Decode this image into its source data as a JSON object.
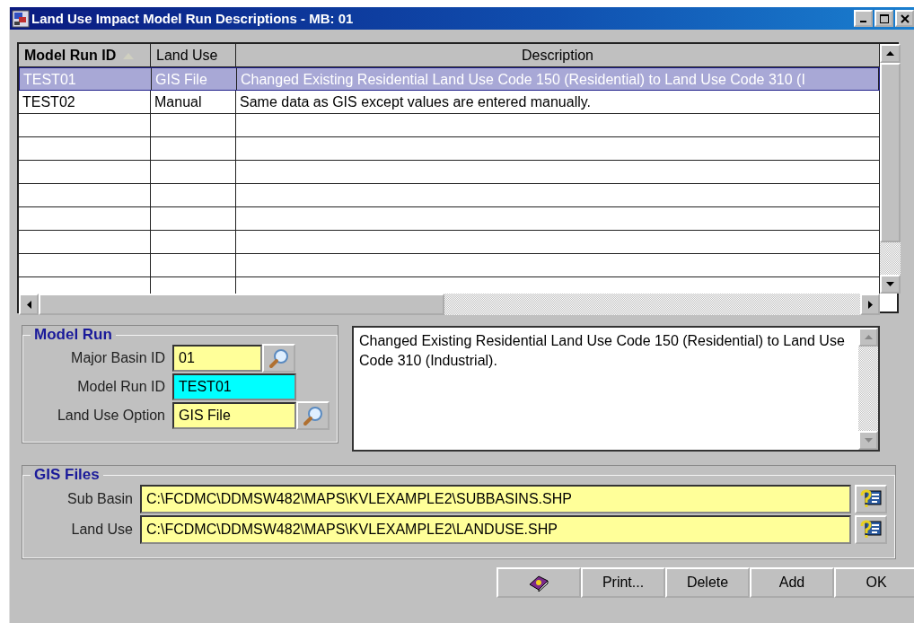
{
  "window": {
    "title": "Land Use Impact Model Run Descriptions - MB: 01"
  },
  "table": {
    "columns": [
      {
        "label": "Model Run ID",
        "sorted": true
      },
      {
        "label": "Land Use",
        "sorted": false
      },
      {
        "label": "Description",
        "sorted": false
      }
    ],
    "rows": [
      {
        "cells": [
          "TEST01",
          "GIS File",
          "Changed Existing Residential Land Use Code 150 (Residential) to Land Use Code 310 (I"
        ],
        "selected": true
      },
      {
        "cells": [
          "TEST02",
          "Manual",
          "Same data as GIS except values are entered manually."
        ],
        "selected": false
      }
    ]
  },
  "model_run": {
    "title": "Model Run",
    "fields": [
      {
        "label": "Major Basin ID",
        "value": "01",
        "highlighted": false,
        "has_lookup": true
      },
      {
        "label": "Model Run ID",
        "value": "TEST01",
        "highlighted": true,
        "has_lookup": false
      },
      {
        "label": "Land Use Option",
        "value": "GIS File",
        "highlighted": false,
        "has_lookup": true
      }
    ]
  },
  "description": {
    "value": "Changed Existing Residential Land Use Code 150 (Residential) to Land Use Code 310 (Industrial)."
  },
  "gis_files": {
    "title": "GIS Files",
    "fields": [
      {
        "label": "Sub Basin",
        "value": "C:\\FCDMC\\DDMSW482\\MAPS\\KVLEXAMPLE2\\SUBBASINS.SHP"
      },
      {
        "label": "Land Use",
        "value": "C:\\FCDMC\\DDMSW482\\MAPS\\KVLEXAMPLE2\\LANDUSE.SHP"
      }
    ]
  },
  "buttons": [
    {
      "kind": "help"
    },
    {
      "kind": "text",
      "label": "Print..."
    },
    {
      "kind": "text",
      "label": "Delete"
    },
    {
      "kind": "text",
      "label": "Add"
    },
    {
      "kind": "text",
      "label": "OK"
    }
  ]
}
